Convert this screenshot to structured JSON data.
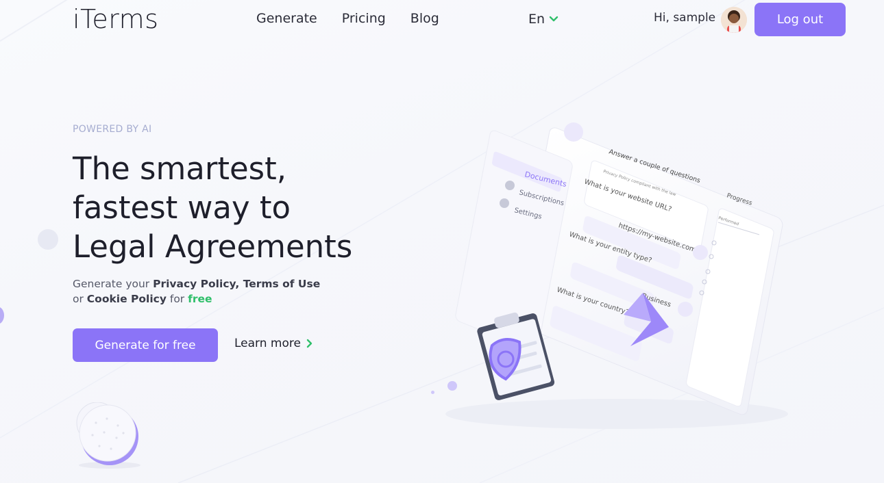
{
  "brand": {
    "name": "iTerms"
  },
  "nav": {
    "items": [
      {
        "label": "Generate"
      },
      {
        "label": "Pricing"
      },
      {
        "label": "Blog"
      }
    ],
    "language": "En"
  },
  "user": {
    "greeting": "Hi, sample",
    "logout_label": "Log out"
  },
  "hero": {
    "eyebrow": "POWERED BY AI",
    "headline": [
      "The smartest,",
      "fastest way to",
      "Legal Agreements"
    ],
    "sub_prefix": "Generate your ",
    "privacy": "Privacy Policy",
    "comma": ", ",
    "terms": "Terms of Use",
    "or": "or ",
    "cookie": "Cookie Policy",
    "for": " for ",
    "free": "free",
    "cta_label": "Generate for free",
    "learn_label": "Learn more"
  },
  "illustration": {
    "menu": [
      "Documents",
      "Subscriptions",
      "Settings"
    ],
    "card_title": "Answer a couple of questions",
    "card_sub": "Privacy Policy compliant with the law",
    "question_url": "What is your website URL?",
    "answer_url": "https://my-website.com",
    "question_entity": "What is your entity type?",
    "answer_entity": "Business",
    "question_country": "What is your country?",
    "progress_title": "Progress",
    "progress_label": "Performed"
  },
  "colors": {
    "accent": "#8b74f7",
    "free_green": "#2fbf6a",
    "eyebrow": "#a6acd0"
  }
}
